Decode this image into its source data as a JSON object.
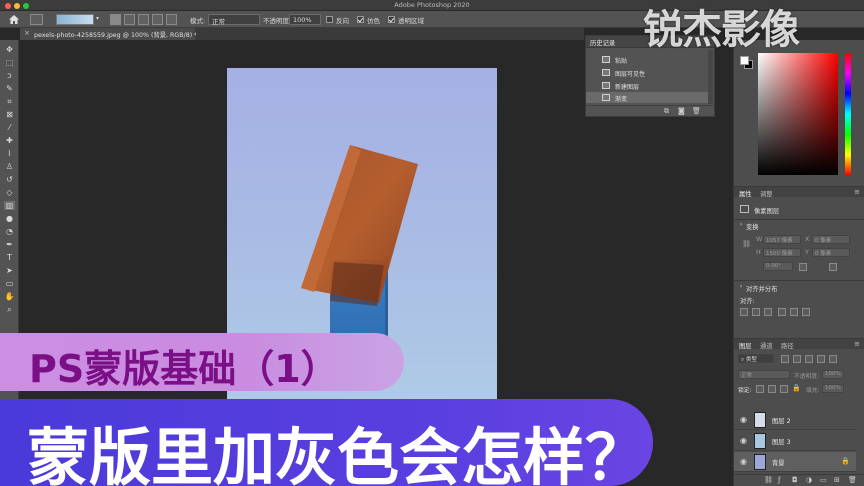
{
  "window": {
    "title": "Adobe Photoshop 2020",
    "traffic_colors": [
      "#ff5f57",
      "#febc2e",
      "#28c840"
    ]
  },
  "options_bar": {
    "mode_label": "模式:",
    "mode_value": "正常",
    "opacity_label": "不透明度:",
    "opacity_value": "100%",
    "reverse_label": "反向",
    "dither_label": "仿色",
    "transparency_label": "透明区域",
    "gradient_colors": [
      "#8ab3d3",
      "#c9dcef"
    ]
  },
  "document_tab": {
    "label": "pexels-photo-4258559.jpeg @ 100% (背景, RGB/8) *",
    "close": "×"
  },
  "history": {
    "tab_label": "历史记录",
    "items": [
      {
        "label": "粘贴"
      },
      {
        "label": "图层可见性"
      },
      {
        "label": "新建图层"
      },
      {
        "label": "渐变"
      }
    ],
    "active_index": 3
  },
  "properties": {
    "tab_properties": "属性",
    "tab_adjustments": "调整",
    "pixel_layer_label": "像素图层",
    "transform_label": "变换",
    "w_label": "W",
    "w_value": "1057 像素",
    "h_label": "H",
    "h_value": "1500 像素",
    "x_label": "X",
    "x_value": "0 像素",
    "y_label": "Y",
    "y_value": "0 像素",
    "angle_value": "0.00°",
    "align_section": "对齐并分布",
    "align_label": "对齐:"
  },
  "layers_panel": {
    "tab_layers": "图层",
    "tab_channels": "通道",
    "tab_paths": "路径",
    "filter_label": "类型",
    "blend_mode": "正常",
    "opacity_label": "不透明度:",
    "opacity_value": "100%",
    "lock_label": "锁定:",
    "fill_label": "填充:",
    "fill_value": "100%",
    "layers": [
      {
        "name": "图层 2",
        "thumb": "#d7dbe8"
      },
      {
        "name": "图层 3",
        "thumb": "#a8c8e2"
      },
      {
        "name": "背景",
        "thumb": "#9aa7d8"
      }
    ],
    "selected_index": 2
  },
  "overlay": {
    "line1": "PS蒙版基础（1）",
    "line2": "蒙版里加灰色会怎样？",
    "line1_bg": "#cb8ee2",
    "line1_color": "#7a0f86",
    "line2_bg": "#4a3ad9"
  },
  "watermark": {
    "text": "锐杰影像"
  },
  "icons": {
    "home": "home-icon",
    "move": "move-tool-icon",
    "eye": "eye-icon",
    "lock": "lock-icon"
  }
}
